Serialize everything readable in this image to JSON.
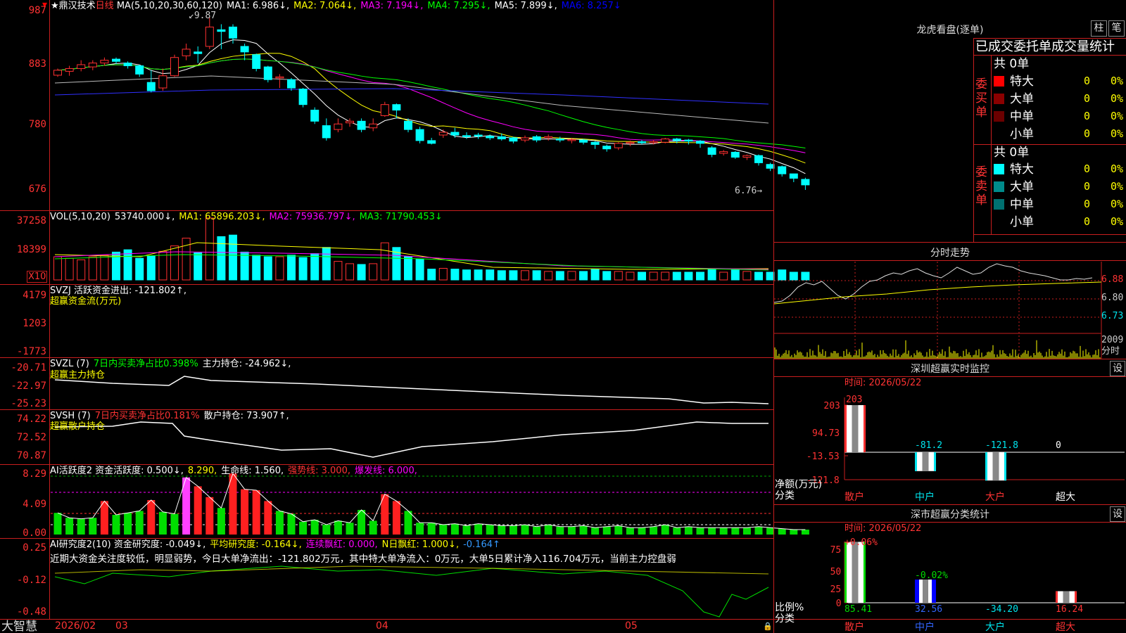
{
  "stock": {
    "star": "★",
    "name": "鼎汉技术",
    "period": "日线"
  },
  "ma_line": [
    {
      "t": "MA(5,10,20,30,60,120)",
      "c": "#ffffff"
    },
    {
      "t": "MA1: 6.986↓,",
      "c": "#ffffff"
    },
    {
      "t": "MA2: 7.064↓,",
      "c": "#ffff00"
    },
    {
      "t": "MA3: 7.194↓,",
      "c": "#ff00ff"
    },
    {
      "t": "MA4: 7.295↓,",
      "c": "#00ff00"
    },
    {
      "t": "MA5: 7.899↓,",
      "c": "#ffffff"
    },
    {
      "t": "MA6: 8.257↓",
      "c": "#0000ff"
    }
  ],
  "price_axis": [
    "987",
    "883",
    "780",
    "676"
  ],
  "price_high": "9.87",
  "price_low": "6.76",
  "vol_line": [
    {
      "t": "VOL(5,10,20)",
      "c": "#ffffff"
    },
    {
      "t": "53740.000↓,",
      "c": "#ffffff"
    },
    {
      "t": "MA1: 65896.203↓,",
      "c": "#ffff00"
    },
    {
      "t": "MA2: 75936.797↓,",
      "c": "#ff00ff"
    },
    {
      "t": "MA3: 71790.453↓",
      "c": "#00ff00"
    }
  ],
  "vol_axis": [
    "37258",
    "18399"
  ],
  "vol_unit": "X10",
  "svzj_line": [
    {
      "t": "SVZJ  活跃资金进出: -121.802↑,",
      "c": "#ffffff"
    }
  ],
  "svzj_sub": "超赢资金流(万元)",
  "svzj_axis": [
    "4179",
    "1203",
    "-1773"
  ],
  "svzl_line": [
    {
      "t": "SVZL (7)",
      "c": "#ffffff"
    },
    {
      "t": "7日内买卖净占比0.398%",
      "c": "#00ff00"
    },
    {
      "t": "主力持仓: -24.962↓,",
      "c": "#ffffff"
    }
  ],
  "svzl_sub": "超赢主力持仓",
  "svzl_axis": [
    "-20.71",
    "-22.97",
    "-25.23"
  ],
  "svsh_line": [
    {
      "t": "SVSH (7)",
      "c": "#ffffff"
    },
    {
      "t": "7日内买卖净占比0.181%",
      "c": "#ff3333"
    },
    {
      "t": "散户持仓: 73.907↑,",
      "c": "#ffffff"
    }
  ],
  "svsh_sub": "超赢散户持仓",
  "svsh_axis": [
    "74.22",
    "72.52",
    "70.87"
  ],
  "ai1_line": [
    {
      "t": "AI活跃度2 资金活跃度: 0.500↓,",
      "c": "#ffffff"
    },
    {
      "t": "8.290,",
      "c": "#ffff00"
    },
    {
      "t": "生命线: 1.560,",
      "c": "#ffffff"
    },
    {
      "t": "强势线: 3.000,",
      "c": "#ff3333"
    },
    {
      "t": "爆发线: 6.000,",
      "c": "#ff00ff"
    }
  ],
  "ai1_axis": [
    "8.29",
    "4.09",
    "0.00"
  ],
  "ai2_line": [
    {
      "t": "AI研究度2(10) 资金研究度: -0.049↓,",
      "c": "#ffffff"
    },
    {
      "t": "平均研究度: -0.164↓,",
      "c": "#ffff00"
    },
    {
      "t": "连续飘红: 0.000,",
      "c": "#ff00ff"
    },
    {
      "t": "N日飘红: 1.000↓,",
      "c": "#ffff00"
    },
    {
      "t": "-0.164↑",
      "c": "#3399ff"
    }
  ],
  "ai2_note": "近期大资金关注度较低，明显弱势，今日大单净流出：-121.802万元，其中特大单净流入：0万元，大单5日累计净入116.704万元，当前主力控盘弱",
  "ai2_axis": [
    "0.25",
    "-0.12",
    "-0.48"
  ],
  "date_axis": [
    "2026/02",
    "03",
    "04",
    "05"
  ],
  "brand": "大智慧",
  "right": {
    "lhkp": {
      "title": "龙虎看盘(逐单)",
      "btn1": "柱",
      "btn2": "笔",
      "subtitle": "已成交委托单成交量统计",
      "buy": {
        "side": "委买单",
        "count": "共 0单",
        "rows": [
          {
            "name": "特大",
            "v": "0",
            "p": "0%",
            "c": "#ff0000"
          },
          {
            "name": "大单",
            "v": "0",
            "p": "0%",
            "c": "#8b0000"
          },
          {
            "name": "中单",
            "v": "0",
            "p": "0%",
            "c": "#6b0000"
          },
          {
            "name": "小单",
            "v": "0",
            "p": "0%",
            "c": ""
          }
        ]
      },
      "sell": {
        "side": "委卖单",
        "count": "共 0单",
        "rows": [
          {
            "name": "特大",
            "v": "0",
            "p": "0%",
            "c": "#00ffff"
          },
          {
            "name": "大单",
            "v": "0",
            "p": "0%",
            "c": "#008b8b"
          },
          {
            "name": "中单",
            "v": "0",
            "p": "0%",
            "c": "#007070"
          },
          {
            "name": "小单",
            "v": "0",
            "p": "0%",
            "c": ""
          }
        ]
      }
    },
    "fs": {
      "title": "分时走势",
      "p1": "6.88",
      "p2": "6.80",
      "p3": "6.73",
      "vol": "2009",
      "vol_unit": "分时"
    },
    "sz": {
      "title": "深圳超赢实时监控",
      "btn": "设",
      "time_label": "时间: 2026/05/22",
      "axis": [
        "203",
        "94.73",
        "-13.53",
        "-121.8"
      ],
      "unit": "净额(万元)",
      "unit2": "分类",
      "cats": [
        "散户",
        "中户",
        "大户",
        "超大"
      ],
      "values": [
        "203",
        "-81.2",
        "-121.8",
        "0"
      ],
      "chart_data": {
        "type": "bar",
        "categories": [
          "散户",
          "中户",
          "大户",
          "超大"
        ],
        "values": [
          203,
          -81.2,
          -121.8,
          0
        ],
        "ylim": [
          -121.8,
          203
        ]
      }
    },
    "fl": {
      "title": "深市超赢分类统计",
      "btn": "设",
      "time_label": "时间: 2026/05/22",
      "axis": [
        "75",
        "50",
        "25",
        "0"
      ],
      "unit": "比例%",
      "unit2": "分类",
      "tops": [
        "+0.06%",
        "-0.02%"
      ],
      "cats": [
        "散户",
        "中户",
        "大户",
        "超大"
      ],
      "values": [
        "85.41",
        "32.56",
        "-34.20",
        "16.24"
      ],
      "chart_data": {
        "type": "bar",
        "categories": [
          "散户",
          "中户",
          "大户",
          "超大"
        ],
        "values": [
          85.41,
          32.56,
          -34.2,
          16.24
        ],
        "ylim": [
          0,
          75
        ]
      }
    }
  }
}
